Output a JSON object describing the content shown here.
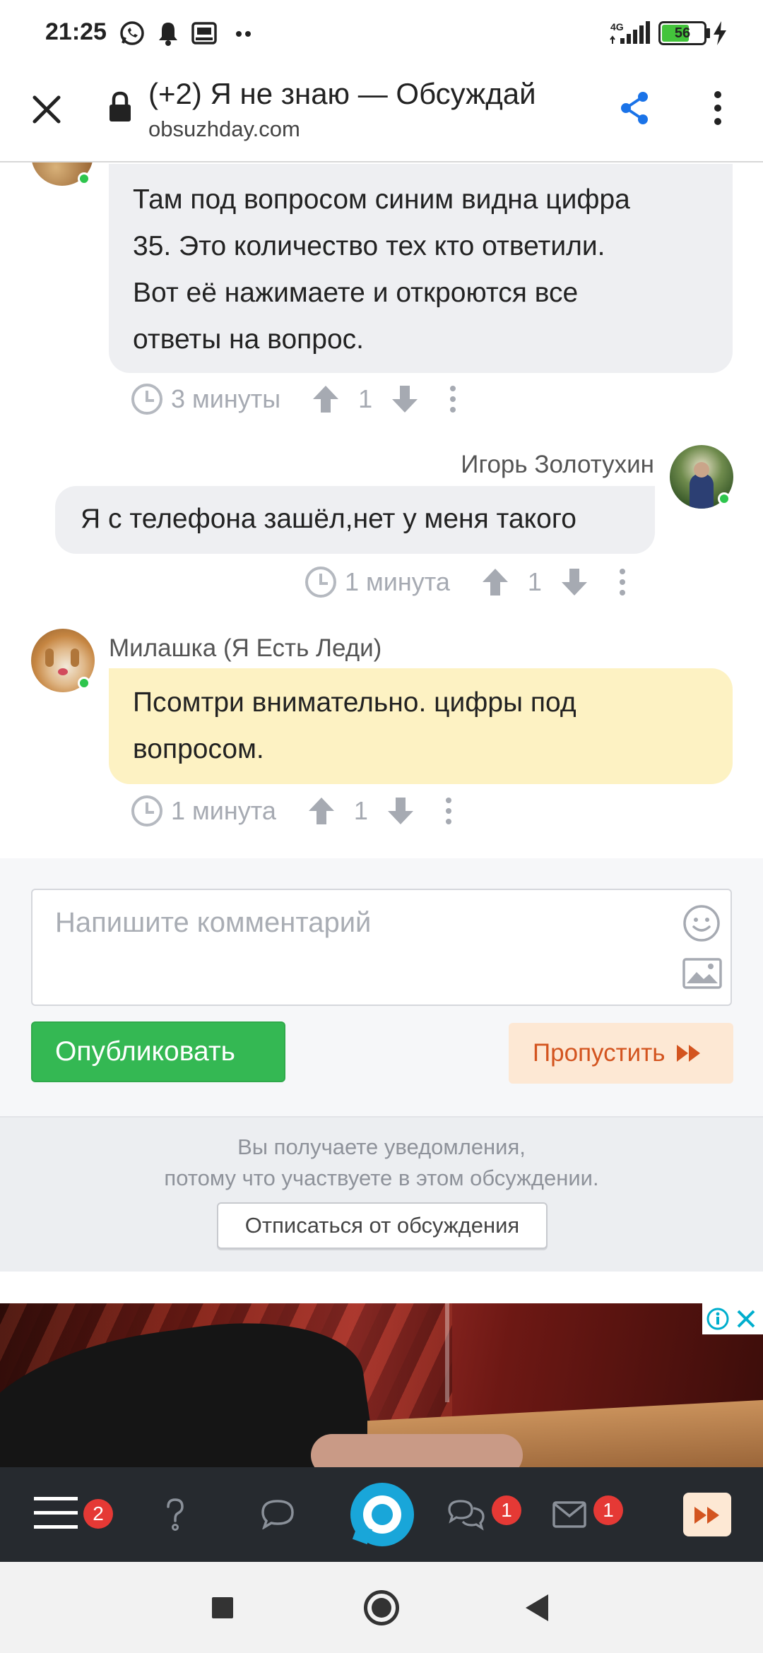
{
  "status_bar": {
    "time": "21:25",
    "network": "4G",
    "battery": "56"
  },
  "browser": {
    "title": "(+2) Я не знаю — Обсуждай",
    "domain": "obsuzhday.com"
  },
  "comments": [
    {
      "text_lines": [
        "Там под вопросом синим видна цифра",
        "35. Это количество тех кто ответили.",
        "Вот её нажимаете и откроются все",
        "ответы на вопрос."
      ],
      "time": "3 минуты",
      "votes": "1"
    },
    {
      "author": "Игорь Золотухин",
      "text": "Я с телефона зашёл,нет у меня такого",
      "time": "1 минута",
      "votes": "1"
    },
    {
      "author": "Милашка (Я Есть Леди)",
      "text_lines": [
        "Псомтри внимательно. цифры под",
        "вопросом."
      ],
      "time": "1 минута",
      "votes": "1"
    }
  ],
  "composer": {
    "placeholder": "Напишите комментарий",
    "publish_label": "Опубликовать",
    "skip_label": "Пропустить"
  },
  "notice": {
    "line1": "Вы получаете уведомления,",
    "line2": "потому что участвуете в этом обсуждении.",
    "unsubscribe_label": "Отписаться от обсуждения"
  },
  "app_nav": {
    "menu_badge": "2",
    "chats_badge": "1",
    "messages_badge": "1"
  },
  "colors": {
    "accent_green": "#34b853",
    "skip_orange": "#d3541f",
    "share_blue": "#1a73e8",
    "bubble_yellow": "#fdf2c3",
    "bubble_gray": "#eeeff2",
    "nav_dark": "#262a2f"
  }
}
